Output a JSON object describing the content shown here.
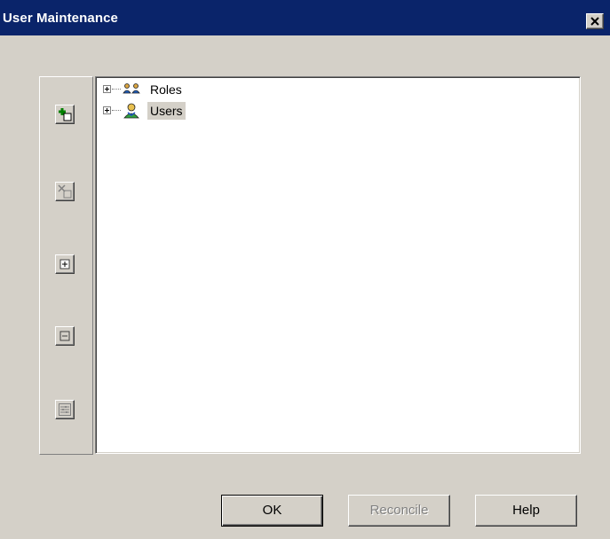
{
  "window": {
    "title": "User Maintenance",
    "close_icon": "close-icon"
  },
  "toolbar": {
    "buttons": [
      {
        "name": "add-button",
        "icon": "add-icon",
        "enabled": true
      },
      {
        "name": "delete-button",
        "icon": "delete-icon",
        "enabled": false
      },
      {
        "name": "expand-button",
        "icon": "expand-icon",
        "enabled": true
      },
      {
        "name": "collapse-button",
        "icon": "collapse-icon",
        "enabled": true
      },
      {
        "name": "properties-button",
        "icon": "properties-icon",
        "enabled": true
      }
    ]
  },
  "tree": {
    "nodes": [
      {
        "label": "Roles",
        "icon": "roles-icon",
        "selected": false
      },
      {
        "label": "Users",
        "icon": "user-icon",
        "selected": true
      }
    ]
  },
  "buttons": {
    "ok_label": "OK",
    "reconcile_label": "Reconcile",
    "help_label": "Help"
  },
  "colors": {
    "titlebar": "#0a246a",
    "face": "#d4d0c8"
  }
}
